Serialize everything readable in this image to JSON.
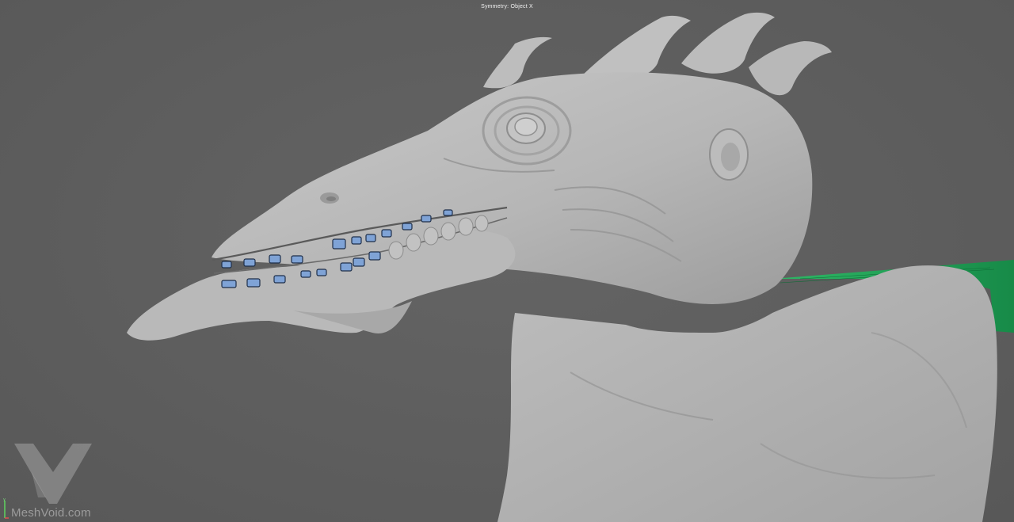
{
  "viewport": {
    "symmetry_status": "Symmetry: Object X"
  },
  "overlay": {
    "watermark_text": "MeshVoid.com",
    "watermark_logo": "meshvoid-logo-icon"
  },
  "scene": {
    "model": "creature-head-sculpt",
    "background_color": "#5e5e5e",
    "model_color": "#b8b8b8",
    "selected_teeth_color": "#7fa3d6",
    "ground_grid_color": "#1fa35a"
  }
}
